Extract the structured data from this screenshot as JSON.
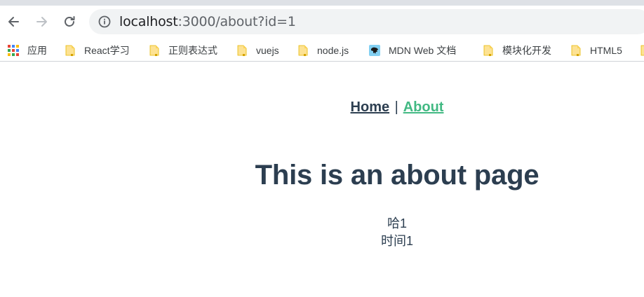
{
  "browser": {
    "url_host": "localhost",
    "url_path": ":3000/about?id=1"
  },
  "bookmarks": [
    {
      "label": "应用",
      "icon": "apps-grid-icon"
    },
    {
      "label": "React学习",
      "icon": "folder-icon"
    },
    {
      "label": "正则表达式",
      "icon": "folder-icon"
    },
    {
      "label": "vuejs",
      "icon": "folder-icon"
    },
    {
      "label": "node.js",
      "icon": "folder-icon"
    },
    {
      "label": "MDN Web 文档",
      "icon": "mdn-dino-icon"
    },
    {
      "label": "模块化开发",
      "icon": "folder-icon"
    },
    {
      "label": "HTML5",
      "icon": "folder-icon"
    }
  ],
  "page": {
    "nav": {
      "home": "Home",
      "separator": "|",
      "about": "About"
    },
    "title": "This is an about page",
    "line1": "哈1",
    "line2": "时间1"
  },
  "colors": {
    "text": "#2c3e50",
    "active_link": "#42b983",
    "folder": "#fdd663",
    "mdn": "#83d0f2"
  }
}
